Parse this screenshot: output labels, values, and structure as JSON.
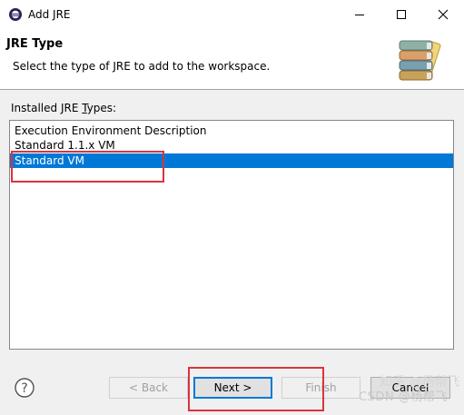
{
  "window": {
    "title": "Add JRE",
    "icon": "eclipse-icon"
  },
  "banner": {
    "title": "JRE Type",
    "description": "Select the type of JRE to add to the workspace.",
    "image": "jre-books-icon"
  },
  "jre_list": {
    "label_prefix": "Installed JRE ",
    "label_mnemonic": "T",
    "label_suffix": "ypes:",
    "items": [
      {
        "label": "Execution Environment Description",
        "selected": false
      },
      {
        "label": "Standard 1.1.x VM",
        "selected": false
      },
      {
        "label": "Standard VM",
        "selected": true
      }
    ]
  },
  "buttons": {
    "back": "< Back",
    "next": "Next >",
    "finish": "Finish",
    "cancel": "Cancel"
  },
  "watermark": {
    "zh": "知乎 @杨帮飞",
    "csdn": "CSDN @杨帮飞"
  },
  "colors": {
    "selection": "#0078d7",
    "highlight_box": "#d9343c"
  }
}
